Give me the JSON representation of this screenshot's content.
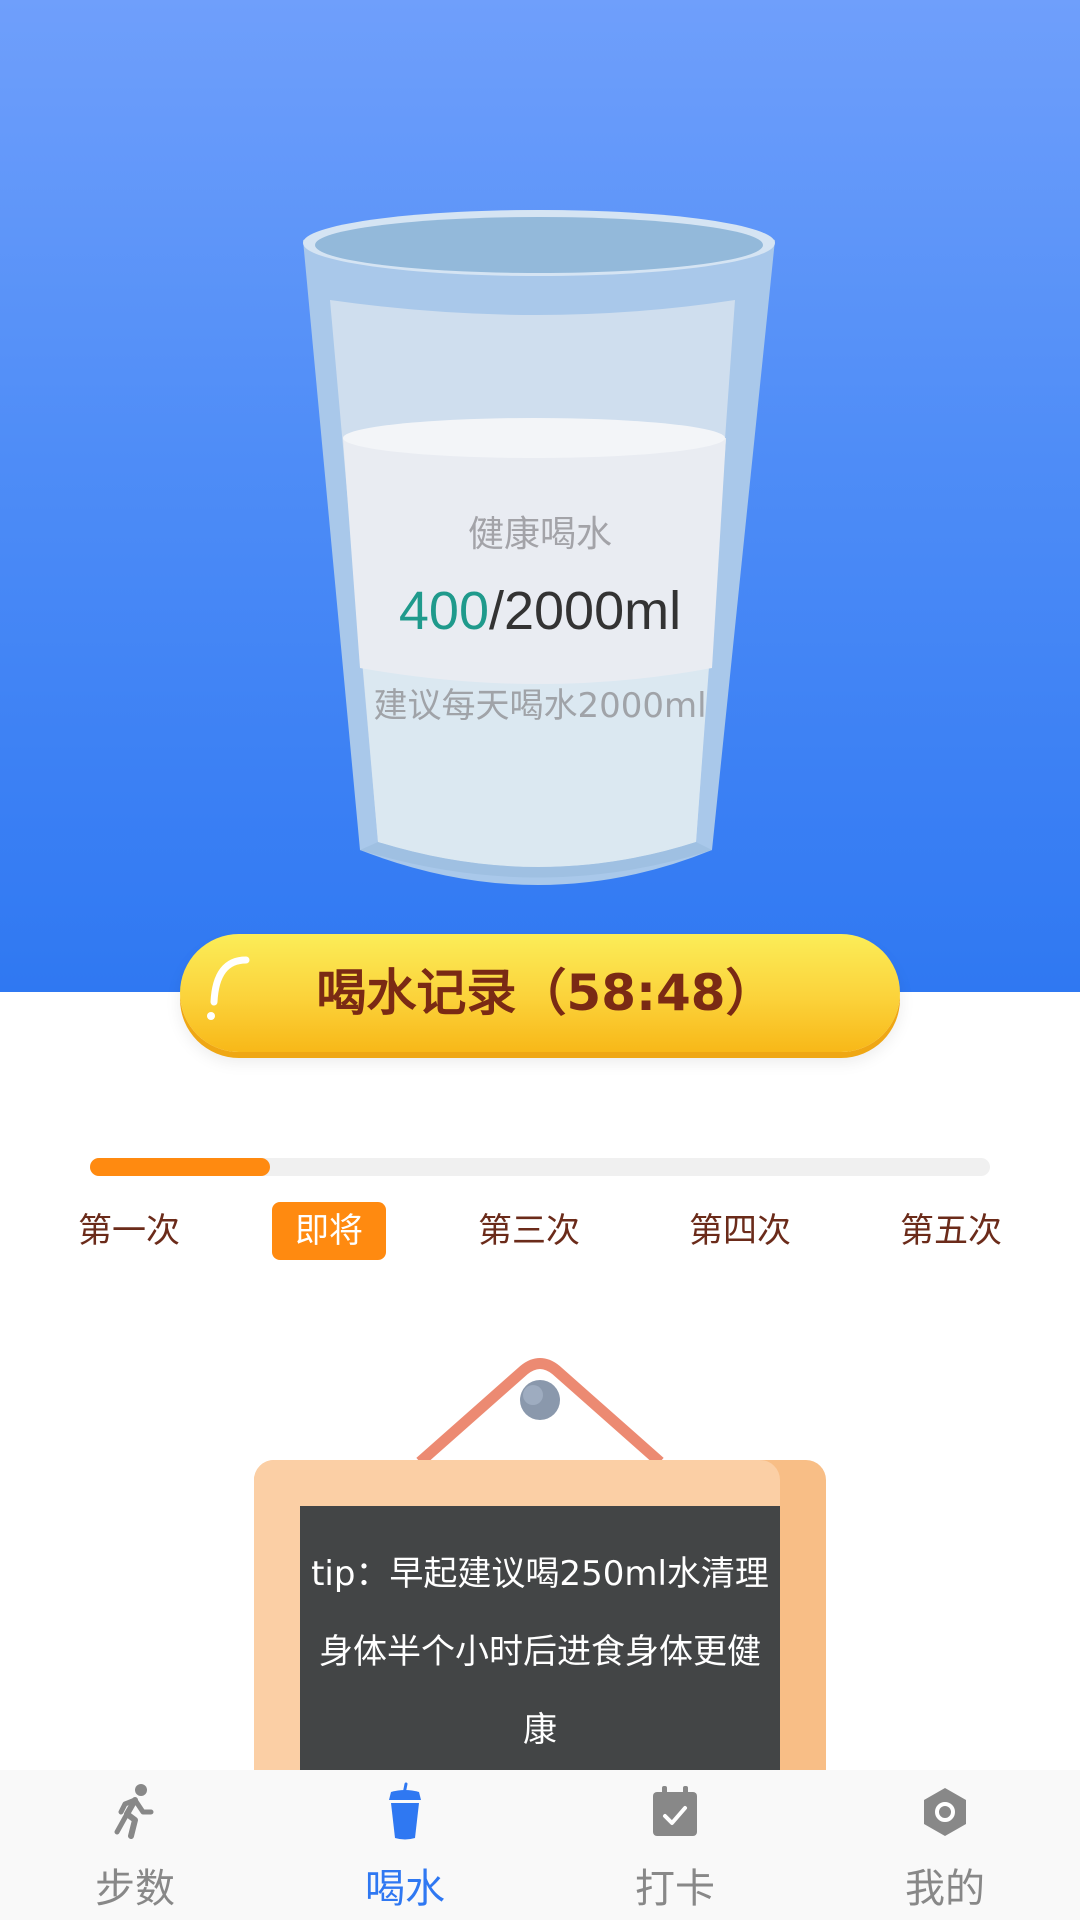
{
  "glass": {
    "title": "健康喝水",
    "current_ml": "400",
    "goal": "/2000ml",
    "hint": "建议每天喝水2000ml"
  },
  "record_button": {
    "label": "喝水记录（58:48）"
  },
  "progress": {
    "fraction": 0.2,
    "steps": [
      {
        "label": "第一次",
        "active": false
      },
      {
        "label": "即将",
        "active": true
      },
      {
        "label": "第三次",
        "active": false
      },
      {
        "label": "第四次",
        "active": false
      },
      {
        "label": "第五次",
        "active": false
      }
    ]
  },
  "tip": {
    "text": "tip：早起建议喝250ml水清理身体半个小时后进食身体更健康"
  },
  "bottom_nav": {
    "items": [
      {
        "label": "步数",
        "icon": "walking-person-icon",
        "active": false
      },
      {
        "label": "喝水",
        "icon": "water-cup-icon",
        "active": true
      },
      {
        "label": "打卡",
        "icon": "calendar-check-icon",
        "active": false
      },
      {
        "label": "我的",
        "icon": "hexagon-user-icon",
        "active": false
      }
    ]
  },
  "colors": {
    "hero_top": "#6f9ffb",
    "hero_bottom": "#2f78f2",
    "accent_orange": "#ff8a10",
    "teal_amount": "#1f9a8c",
    "nav_active": "#2f78f2",
    "nav_inactive": "#888888",
    "button_text": "#7a2a14"
  }
}
